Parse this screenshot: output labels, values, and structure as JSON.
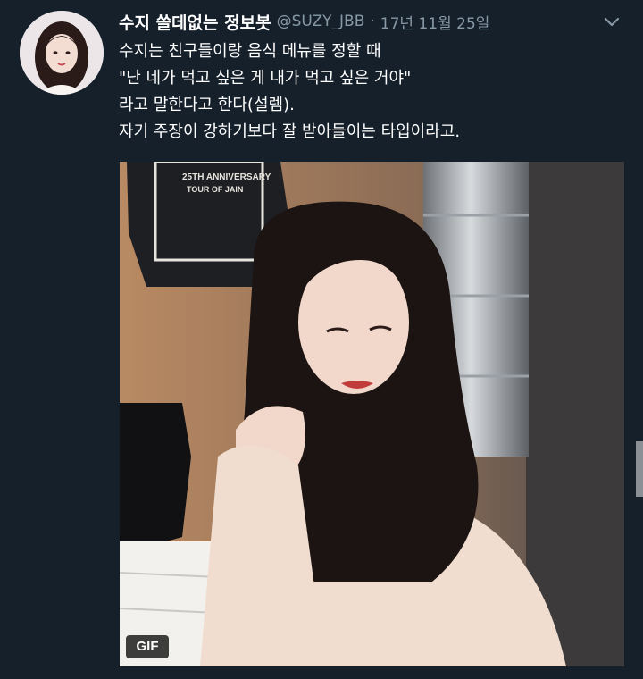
{
  "tweet": {
    "display_name": "수지 쓸데없는 정보봇",
    "handle": "@SUZY_JBB",
    "separator": "·",
    "timestamp": "17년 11월 25일",
    "lines": [
      "수지는 친구들이랑 음식 메뉴를 정할 때",
      "\"난 네가 먹고 싶은 게 내가 먹고 싶은 거야\"",
      "라고 말한다고 한다(설렘).",
      "자기 주장이 강하기보다 잘 받아들이는 타입이라고."
    ],
    "media": {
      "badge": "GIF",
      "poster_text": [
        "25TH ANNIVERSARY",
        "TOUR OF JAIN"
      ]
    }
  },
  "icons": {
    "more": "chevron-down-icon"
  },
  "colors": {
    "background": "#15202b",
    "text": "#ffffff",
    "secondary_text": "#8899a6"
  }
}
